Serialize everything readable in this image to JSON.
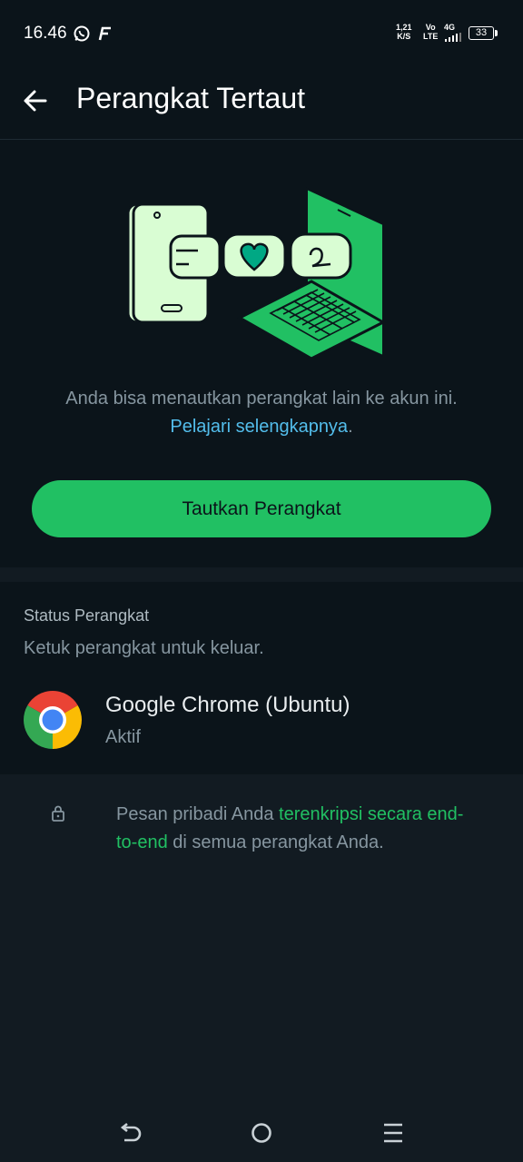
{
  "status_bar": {
    "time": "16.46",
    "net_speed_value": "1,21",
    "net_speed_unit": "K/S",
    "volte_top": "Vo",
    "volte_bottom": "LTE",
    "network": "4G",
    "battery": "33",
    "icons": [
      "whatsapp-icon",
      "notification-f-icon",
      "signal-icon",
      "battery-icon"
    ]
  },
  "app_bar": {
    "title": "Perangkat Tertaut",
    "back_icon": "arrow-left-icon"
  },
  "hero": {
    "description_prefix": "Anda bisa menautkan perangkat lain ke akun ini. ",
    "learn_more": "Pelajari selengkapnya",
    "description_suffix": ".",
    "button_label": "Tautkan Perangkat"
  },
  "devices": {
    "section_title": "Status Perangkat",
    "hint": "Ketuk perangkat untuk keluar.",
    "items": [
      {
        "name": "Google Chrome (Ubuntu)",
        "status": "Aktif",
        "icon": "chrome-icon"
      }
    ]
  },
  "footer": {
    "text_prefix": "Pesan pribadi Anda ",
    "text_highlight": "terenkripsi secara end-to-end",
    "text_suffix": " di semua perangkat Anda.",
    "icon": "lock-icon"
  },
  "colors": {
    "accent": "#21c063",
    "link": "#53bdeb",
    "background": "#0b141a",
    "secondary_text": "#8696a0"
  }
}
